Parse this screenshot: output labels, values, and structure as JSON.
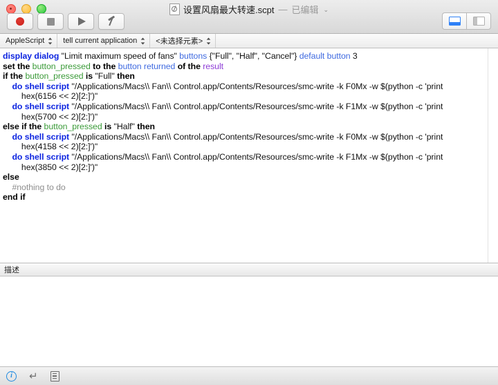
{
  "window": {
    "title_filename": "设置风扇最大转速.scpt",
    "title_dash": "—",
    "title_status": "已编辑",
    "title_chevron": "⌄",
    "traffic_lights": [
      "close",
      "minimize",
      "maximize"
    ]
  },
  "toolbar": {
    "buttons": [
      {
        "name": "record",
        "label": "录制",
        "icon": "record-icon"
      },
      {
        "name": "stop",
        "label": "停止",
        "icon": "stop-icon"
      },
      {
        "name": "run",
        "label": "运行",
        "icon": "play-icon"
      },
      {
        "name": "compile",
        "label": "编译",
        "icon": "hammer-icon"
      }
    ],
    "view_toggles": [
      {
        "name": "bottom-panel",
        "icon": "bottom-panel-icon",
        "active": true
      },
      {
        "name": "side-panel",
        "icon": "side-panel-icon",
        "active": false
      }
    ]
  },
  "navbar": {
    "language_popup": "AppleScript",
    "target_popup": "tell current application",
    "element_popup": "<未选择元素>",
    "chevron": "⇕"
  },
  "editor": {
    "lines": [
      [
        {
          "t": "display dialog ",
          "c": "cmd"
        },
        {
          "t": "\"Limit maximum speed of fans\" ",
          "c": "str"
        },
        {
          "t": "buttons ",
          "c": "ref"
        },
        {
          "t": "{\"Full\", \"Half\", \"Cancel\"} ",
          "c": "str"
        },
        {
          "t": "default button ",
          "c": "ref"
        },
        {
          "t": "3",
          "c": "num"
        }
      ],
      [
        {
          "t": "set the ",
          "c": "kwb"
        },
        {
          "t": "button_pressed ",
          "c": "var"
        },
        {
          "t": "to the ",
          "c": "kwb"
        },
        {
          "t": "button returned ",
          "c": "ref"
        },
        {
          "t": "of the ",
          "c": "kwb"
        },
        {
          "t": "result",
          "c": "val"
        }
      ],
      [
        {
          "t": "if the ",
          "c": "kwb"
        },
        {
          "t": "button_pressed ",
          "c": "var"
        },
        {
          "t": "is ",
          "c": "kwb"
        },
        {
          "t": "\"Full\" ",
          "c": "str"
        },
        {
          "t": "then",
          "c": "kwb"
        }
      ],
      [
        {
          "t": "    do shell script ",
          "c": "cmd"
        },
        {
          "t": "\"/Applications/Macs\\\\ Fan\\\\ Control.app/Contents/Resources/smc-write -k F0Mx -w $(python -c 'print",
          "c": "str"
        }
      ],
      [
        {
          "t": "        hex(6156 << 2)[2:]')\"",
          "c": "str"
        }
      ],
      [
        {
          "t": "    do shell script ",
          "c": "cmd"
        },
        {
          "t": "\"/Applications/Macs\\\\ Fan\\\\ Control.app/Contents/Resources/smc-write -k F1Mx -w $(python -c 'print",
          "c": "str"
        }
      ],
      [
        {
          "t": "        hex(5700 << 2)[2:]')\"",
          "c": "str"
        }
      ],
      [
        {
          "t": "else if the ",
          "c": "kwb"
        },
        {
          "t": "button_pressed ",
          "c": "var"
        },
        {
          "t": "is ",
          "c": "kwb"
        },
        {
          "t": "\"Half\" ",
          "c": "str"
        },
        {
          "t": "then",
          "c": "kwb"
        }
      ],
      [
        {
          "t": "    do shell script ",
          "c": "cmd"
        },
        {
          "t": "\"/Applications/Macs\\\\ Fan\\\\ Control.app/Contents/Resources/smc-write -k F0Mx -w $(python -c 'print",
          "c": "str"
        }
      ],
      [
        {
          "t": "        hex(4158 << 2)[2:]')\"",
          "c": "str"
        }
      ],
      [
        {
          "t": "    do shell script ",
          "c": "cmd"
        },
        {
          "t": "\"/Applications/Macs\\\\ Fan\\\\ Control.app/Contents/Resources/smc-write -k F1Mx -w $(python -c 'print",
          "c": "str"
        }
      ],
      [
        {
          "t": "        hex(3850 << 2)[2:]')\"",
          "c": "str"
        }
      ],
      [
        {
          "t": "else",
          "c": "kwb"
        }
      ],
      [
        {
          "t": "    #nothing to do",
          "c": "cmt"
        }
      ],
      [
        {
          "t": "end if",
          "c": "kwb"
        }
      ]
    ]
  },
  "description": {
    "tab_label": "描述",
    "content": ""
  },
  "statusbar": {
    "icons": [
      {
        "name": "info-icon",
        "glyph": "i"
      },
      {
        "name": "return-arrow-icon",
        "glyph": "↵"
      },
      {
        "name": "document-list-icon",
        "glyph": ""
      }
    ]
  },
  "colors": {
    "command": "#0d25e0",
    "keyword": "#000000",
    "variable": "#3a9a38",
    "reference": "#3f6ae0",
    "value": "#8c3ad6",
    "comment": "#8e8e8e",
    "accent": "#2f81f7"
  }
}
